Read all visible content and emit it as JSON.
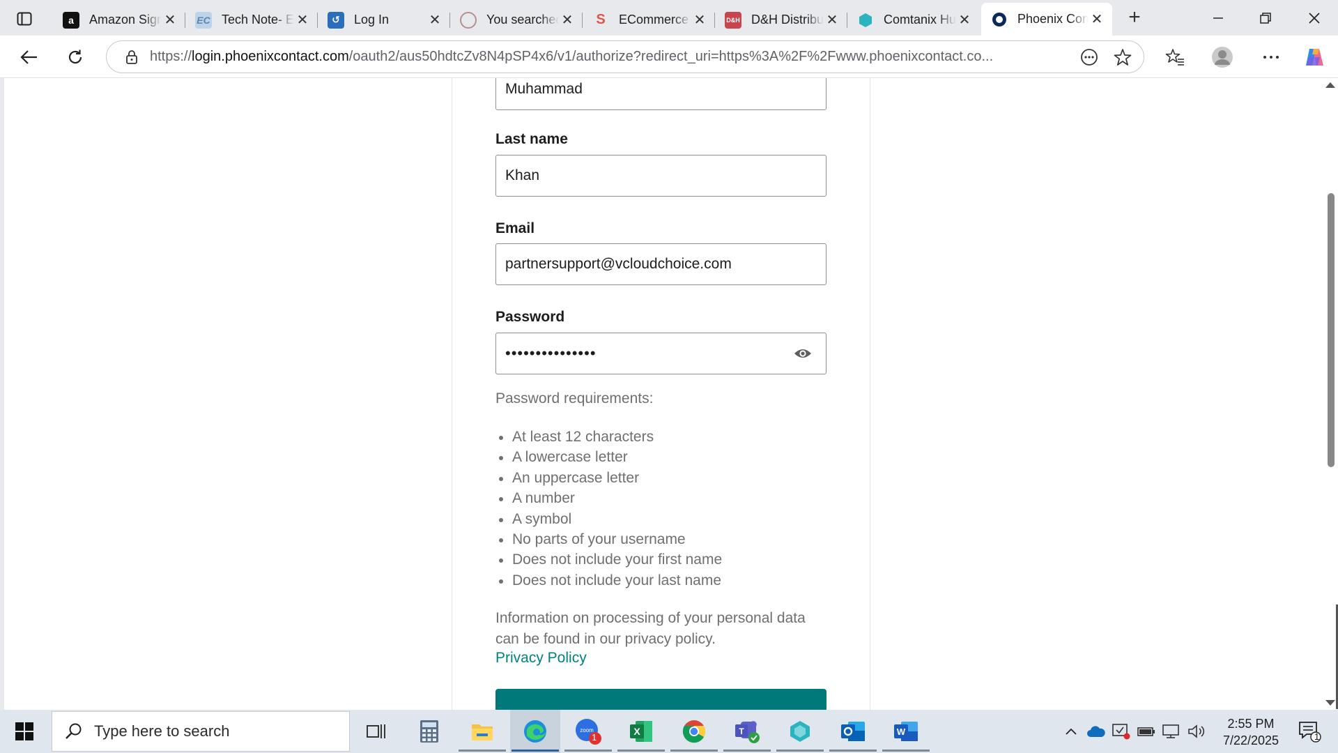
{
  "browser": {
    "tabs": [
      {
        "title": "Amazon Sign-In",
        "icon": "amazon-icon"
      },
      {
        "title": "Tech Note- EC",
        "icon": "ec-icon"
      },
      {
        "title": "Log In",
        "icon": "login-icon"
      },
      {
        "title": "You searched",
        "icon": "search-person-icon"
      },
      {
        "title": "ECommerce",
        "icon": "ecommerce-icon"
      },
      {
        "title": "D&H Distributing",
        "icon": "dh-icon"
      },
      {
        "title": "Comtanix Hub",
        "icon": "comtanix-icon"
      },
      {
        "title": "Phoenix Contact",
        "icon": "phoenix-icon",
        "active": true
      }
    ],
    "address": {
      "scheme": "https://",
      "host": "login.phoenixcontact.com",
      "path": "/oauth2/aus50hdtcZv8N4pSP4x6/v1/authorize?redirect_uri=https%3A%2F%2Fwww.phoenixcontact.co..."
    }
  },
  "form": {
    "first_name_value": "Muhammad",
    "last_name_label": "Last name",
    "last_name_value": "Khan",
    "email_label": "Email",
    "email_value": "partnersupport@vcloudchoice.com",
    "password_label": "Password",
    "password_value": "•••••••••••••••",
    "requirements_title": "Password requirements:",
    "requirements": [
      "At least 12 characters",
      "A lowercase letter",
      "An uppercase letter",
      "A number",
      "A symbol",
      "No parts of your username",
      "Does not include your first name",
      "Does not include your last name"
    ],
    "privacy_text": "Information on processing of your personal data can be found in our privacy policy.",
    "privacy_link": "Privacy Policy",
    "accent_color": "#00797a"
  },
  "taskbar": {
    "search_placeholder": "Type here to search",
    "time": "2:55 PM",
    "date": "7/22/2025",
    "zoom_badge": "1",
    "notification_count": "1"
  }
}
